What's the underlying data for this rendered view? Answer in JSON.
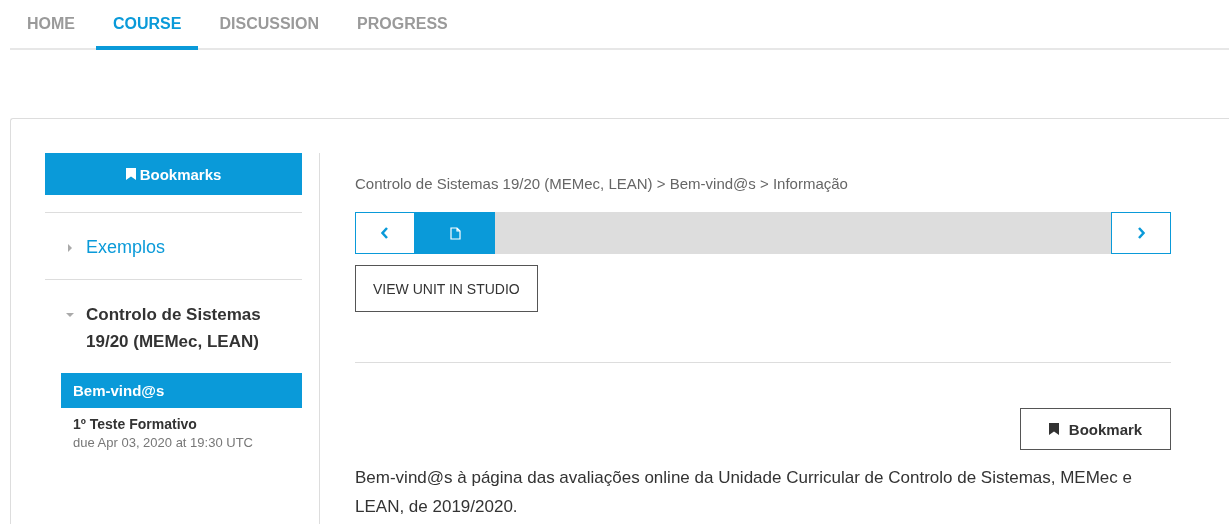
{
  "tabs": [
    {
      "label": "HOME",
      "selected": false
    },
    {
      "label": "COURSE",
      "selected": true
    },
    {
      "label": "DISCUSSION",
      "selected": false
    },
    {
      "label": "PROGRESS",
      "selected": false
    }
  ],
  "sidebar": {
    "bookmarks_button": "Bookmarks",
    "chapters": [
      {
        "title": "Exemplos",
        "expanded": false
      },
      {
        "title": "Controlo de Sistemas 19/20 (MEMec, LEAN)",
        "expanded": true,
        "children": [
          {
            "title": "Bem-vind@s",
            "selected": true
          },
          {
            "title": "1º Teste Formativo",
            "selected": false,
            "due": "due Apr 03, 2020 at 19:30 UTC"
          }
        ]
      }
    ]
  },
  "main": {
    "breadcrumb": "Controlo de Sistemas 19/20 (MEMec, LEAN) > Bem-vind@s > Informação",
    "sequence_units": [
      {
        "selected": true
      }
    ],
    "studio_button": "VIEW UNIT IN STUDIO",
    "bookmark_button": "Bookmark",
    "paragraph": "Bem-vind@s à página das avaliações online da Unidade Curricular de Controlo de Sistemas, MEMec e LEAN, de 2019/2020."
  }
}
